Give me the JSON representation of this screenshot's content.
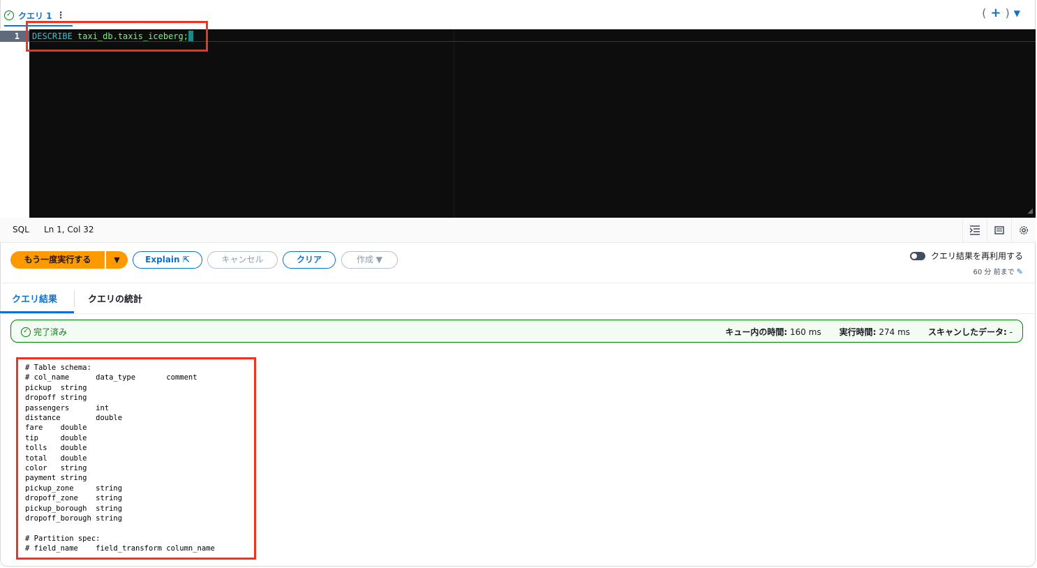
{
  "tab": {
    "label": "クエリ 1",
    "more": "⋮",
    "add": "+",
    "paren_open": "(",
    "paren_close": ")",
    "caret": "▼"
  },
  "editor": {
    "line_number": "1",
    "keyword": "DESCRIBE",
    "identifier": "taxi_db.taxis_iceberg;",
    "theme_bg": "#0d0d0d"
  },
  "status": {
    "language": "SQL",
    "position": "Ln 1, Col 32"
  },
  "actions": {
    "run_again": "もう一度実行する",
    "explain": "Explain",
    "cancel": "キャンセル",
    "clear": "クリア",
    "create": "作成",
    "reuse_label": "クエリ結果を再利用する",
    "reuse_age": "60 分 前まで"
  },
  "result_tabs": {
    "results": "クエリ結果",
    "stats": "クエリの統計"
  },
  "banner": {
    "status": "完了済み",
    "queue_label": "キュー内の時間:",
    "queue_value": "160 ms",
    "exec_label": "実行時間:",
    "exec_value": "274 ms",
    "scan_label": "スキャンしたデータ:",
    "scan_value": "-"
  },
  "output_lines": [
    "# Table schema:",
    "# col_name      data_type       comment",
    "pickup  string",
    "dropoff string",
    "passengers      int",
    "distance        double",
    "fare    double",
    "tip     double",
    "tolls   double",
    "total   double",
    "color   string",
    "payment string",
    "pickup_zone     string",
    "dropoff_zone    string",
    "pickup_borough  string",
    "dropoff_borough string",
    "",
    "# Partition spec:",
    "# field_name    field_transform column_name"
  ],
  "colors": {
    "accent": "#0972d3",
    "primary_button": "#ff9900",
    "success": "#037f0c",
    "highlight": "#f2311e"
  }
}
